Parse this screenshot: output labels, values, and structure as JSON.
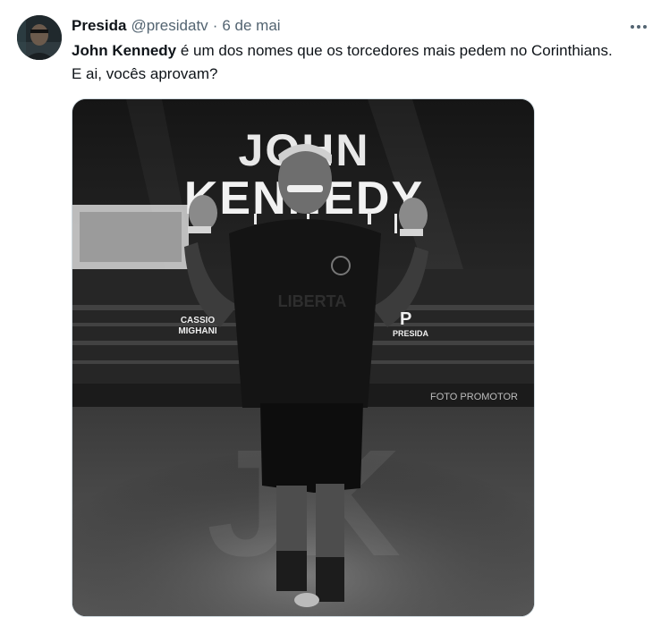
{
  "tweet": {
    "display_name": "Presida",
    "handle": "@presidatv",
    "separator": "·",
    "time": "6 de mai",
    "text_bold": "John Kennedy",
    "text_rest": " é um dos nomes que os torcedores mais pedem no Corinthians. E ai, vocês aprovam?"
  },
  "media": {
    "headline_line1": "JOHN",
    "headline_line2": "KENNEDY",
    "left_badge_line1": "CASSIO",
    "left_badge_line2": "MIGHANI",
    "right_badge": "PRESIDA",
    "shirt_sponsor": "LIBERTA",
    "board_right": "FOTO PROMOTOR"
  },
  "icons": {
    "more": "more-horizontal-icon",
    "avatar": "avatar"
  }
}
